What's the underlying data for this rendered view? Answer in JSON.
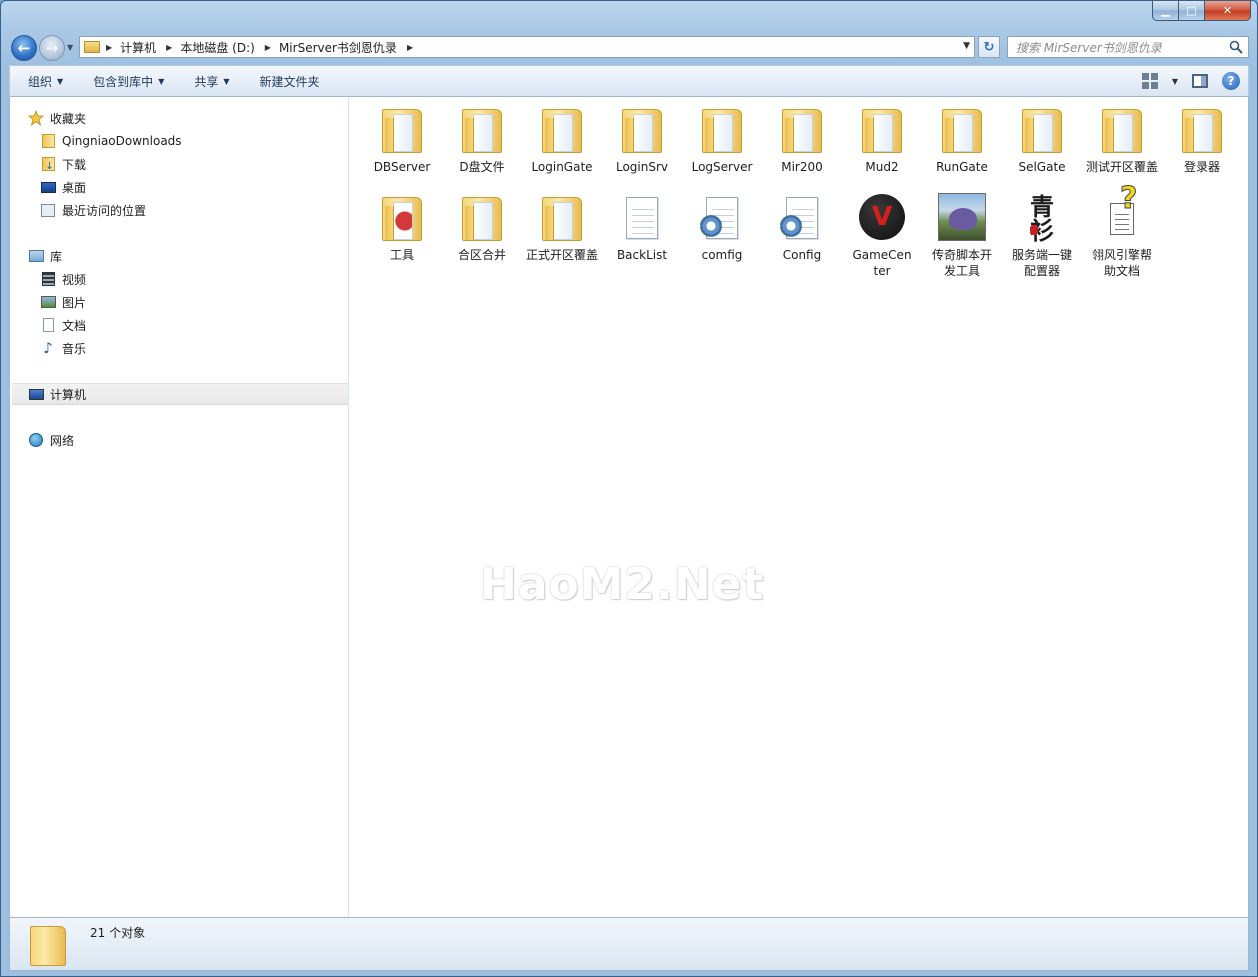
{
  "caption": {
    "minimize": "",
    "maximize": "",
    "close": ""
  },
  "nav": {
    "breadcrumbs": [
      "计算机",
      "本地磁盘 (D:)",
      "MirServer书剑恩仇录"
    ],
    "search_placeholder": "搜索 MirServer书剑恩仇录"
  },
  "toolbar": {
    "organize": "组织",
    "include_library": "包含到库中",
    "share": "共享",
    "new_folder": "新建文件夹"
  },
  "sidebar": {
    "favorites": "收藏夹",
    "fav_items": [
      "QingniaoDownloads",
      "下载",
      "桌面",
      "最近访问的位置"
    ],
    "library": "库",
    "lib_items": [
      "视频",
      "图片",
      "文档",
      "音乐"
    ],
    "computer": "计算机",
    "network": "网络"
  },
  "files": [
    {
      "name": "DBServer",
      "icon": "folder-icon"
    },
    {
      "name": "D盘文件",
      "icon": "folder-icon"
    },
    {
      "name": "LoginGate",
      "icon": "folder-icon"
    },
    {
      "name": "LoginSrv",
      "icon": "folder-icon"
    },
    {
      "name": "LogServer",
      "icon": "folder-icon"
    },
    {
      "name": "Mir200",
      "icon": "folder-icon"
    },
    {
      "name": "Mud2",
      "icon": "folder-icon"
    },
    {
      "name": "RunGate",
      "icon": "folder-icon"
    },
    {
      "name": "SelGate",
      "icon": "folder-icon"
    },
    {
      "name": "测试开区覆盖",
      "icon": "folder-icon"
    },
    {
      "name": "登录器",
      "icon": "folder-icon"
    },
    {
      "name": "工具",
      "icon": "folder-icon"
    },
    {
      "name": "合区合并",
      "icon": "folder-icon"
    },
    {
      "name": "正式开区覆盖",
      "icon": "folder-icon"
    },
    {
      "name": "BackList",
      "icon": "text-file-icon"
    },
    {
      "name": "comfig",
      "icon": "config-file-icon"
    },
    {
      "name": "Config",
      "icon": "config-file-icon"
    },
    {
      "name": "GameCenter",
      "icon": "gamecenter-app-icon"
    },
    {
      "name": "传奇脚本开发工具",
      "icon": "script-tool-app-icon"
    },
    {
      "name": "服务端一键配置器",
      "icon": "server-config-app-icon"
    },
    {
      "name": "翎风引擎帮助文档",
      "icon": "help-document-icon"
    }
  ],
  "watermark": "HaoM2.Net",
  "status": {
    "count": "21 个对象"
  }
}
